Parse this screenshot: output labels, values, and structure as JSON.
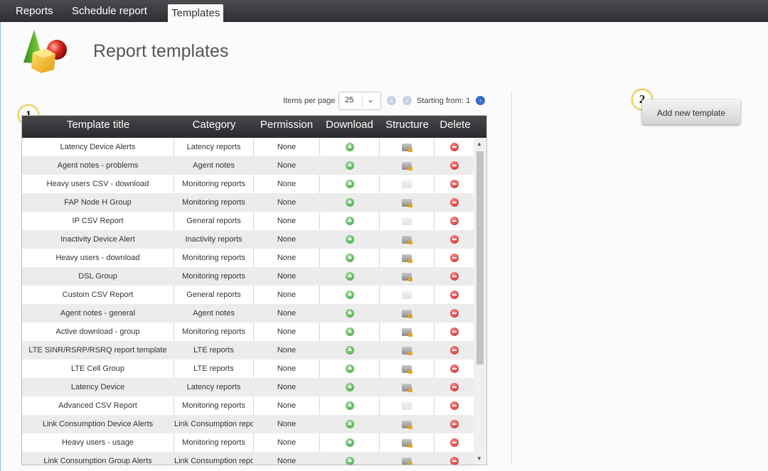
{
  "nav": {
    "tabs": [
      {
        "label": "Reports",
        "active": false
      },
      {
        "label": "Schedule report",
        "active": false
      },
      {
        "label": "Templates",
        "active": true
      }
    ]
  },
  "page": {
    "title": "Report templates",
    "logo_icon": "shapes-logo-icon"
  },
  "callouts": {
    "one": "1",
    "two": "2"
  },
  "pager": {
    "items_per_page_label": "Items per page",
    "items_per_page_value": "25",
    "starting_from_label": "Starting from: 1"
  },
  "table": {
    "columns": [
      "Template title",
      "Category",
      "Permission",
      "Download",
      "Structure",
      "Delete"
    ],
    "rows": [
      {
        "title": "Latency Device Alerts",
        "category": "Latency reports",
        "permission": "None",
        "structure": true
      },
      {
        "title": "Agent notes - problems",
        "category": "Agent notes",
        "permission": "None",
        "structure": true
      },
      {
        "title": "Heavy users CSV - download",
        "category": "Monitoring reports",
        "permission": "None",
        "structure": false
      },
      {
        "title": "FAP Node H Group",
        "category": "Monitoring reports",
        "permission": "None",
        "structure": true
      },
      {
        "title": "IP CSV Report",
        "category": "General reports",
        "permission": "None",
        "structure": false
      },
      {
        "title": "Inactivity Device Alert",
        "category": "Inactivity reports",
        "permission": "None",
        "structure": true
      },
      {
        "title": "Heavy users - download",
        "category": "Monitoring reports",
        "permission": "None",
        "structure": true
      },
      {
        "title": "DSL Group",
        "category": "Monitoring reports",
        "permission": "None",
        "structure": true
      },
      {
        "title": "Custom CSV Report",
        "category": "General reports",
        "permission": "None",
        "structure": false
      },
      {
        "title": "Agent notes - general",
        "category": "Agent notes",
        "permission": "None",
        "structure": true
      },
      {
        "title": "Active download - group",
        "category": "Monitoring reports",
        "permission": "None",
        "structure": true
      },
      {
        "title": "LTE SINR/RSRP/RSRQ report template",
        "category": "LTE reports",
        "permission": "None",
        "structure": true
      },
      {
        "title": "LTE Cell Group",
        "category": "LTE reports",
        "permission": "None",
        "structure": true
      },
      {
        "title": "Latency Device",
        "category": "Latency reports",
        "permission": "None",
        "structure": true
      },
      {
        "title": "Advanced CSV Report",
        "category": "Monitoring reports",
        "permission": "None",
        "structure": false
      },
      {
        "title": "Link Consumption Device Alerts",
        "category": "Link Consumption reports",
        "permission": "None",
        "structure": true
      },
      {
        "title": "Heavy users - usage",
        "category": "Monitoring reports",
        "permission": "None",
        "structure": true
      },
      {
        "title": "Link Consumption Group Alerts",
        "category": "Link Consumption reports",
        "permission": "None",
        "structure": true
      }
    ]
  },
  "actions": {
    "add_template_label": "Add new template"
  },
  "colors": {
    "header_bg": "#2e2e33",
    "alt_row": "#ececec",
    "callout_border": "#f2d24a"
  }
}
